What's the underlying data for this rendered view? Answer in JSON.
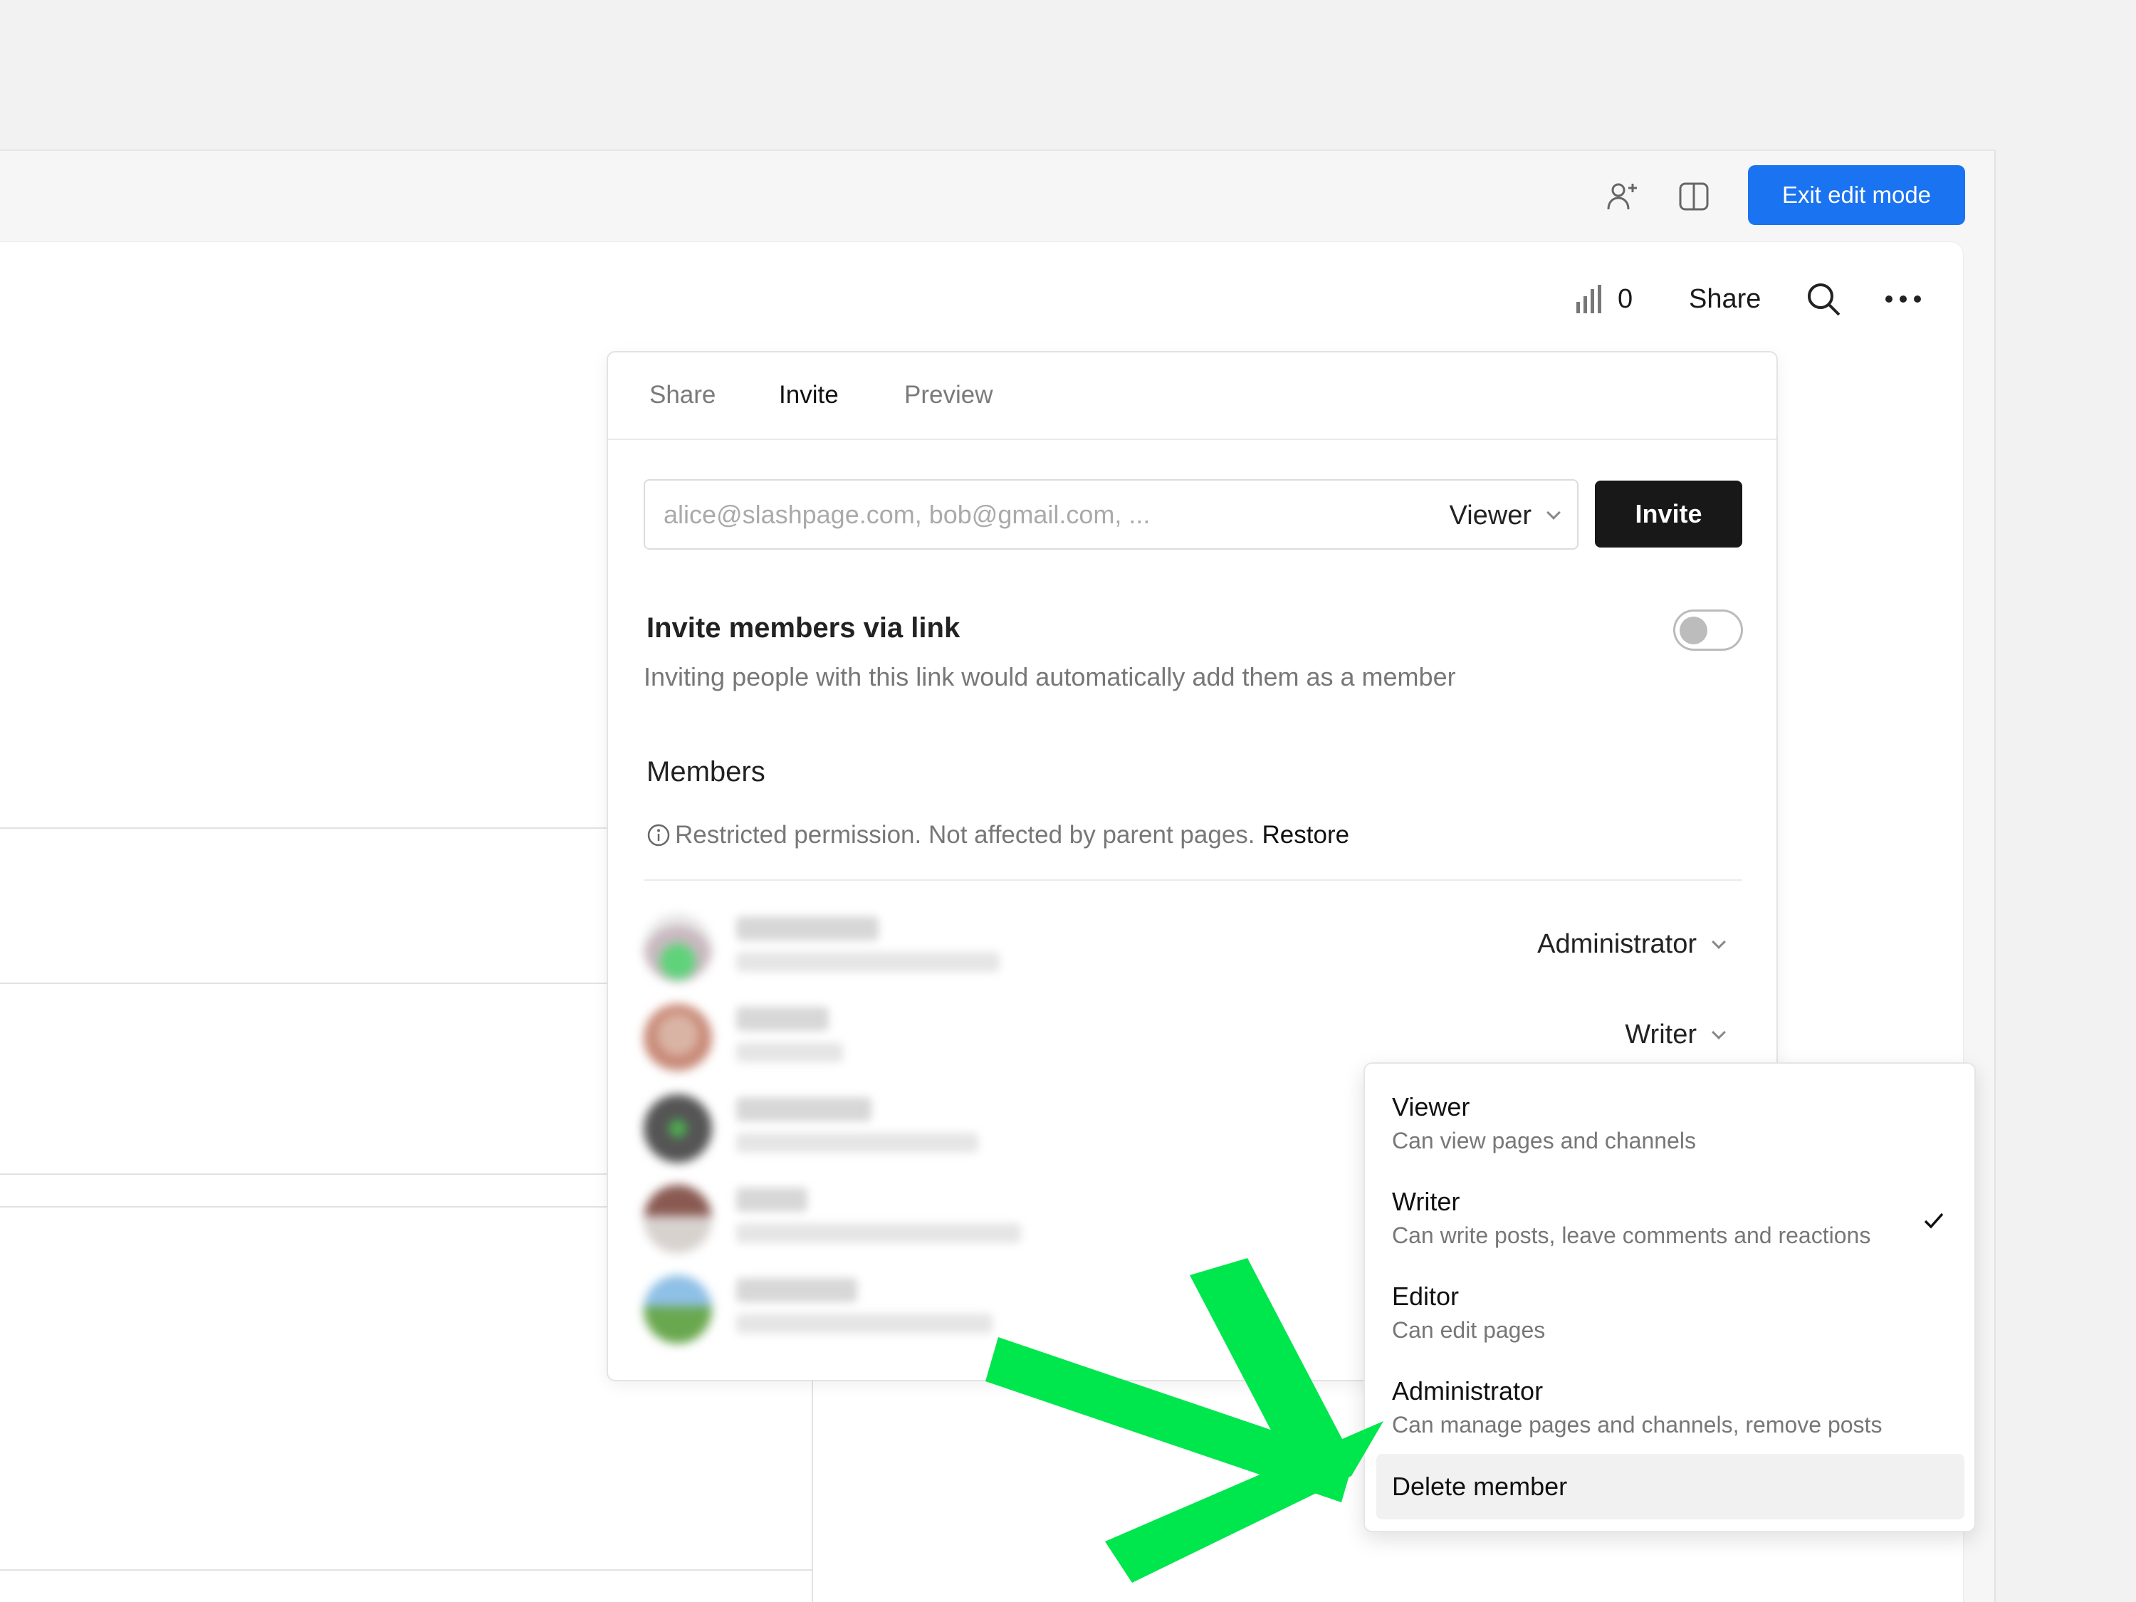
{
  "topbar": {
    "icons": [
      "add-person-icon",
      "split-view-icon"
    ],
    "exit_label": "Exit edit mode",
    "accent_color": "#1a73f0"
  },
  "toolbar": {
    "view_count": "0",
    "share_label": "Share",
    "icons": [
      "stats-icon",
      "search-icon",
      "more-icon"
    ]
  },
  "panel": {
    "tabs": [
      {
        "label": "Share",
        "active": false
      },
      {
        "label": "Invite",
        "active": true
      },
      {
        "label": "Preview",
        "active": false
      }
    ],
    "invite": {
      "placeholder": "alice@slashpage.com, bob@gmail.com, ...",
      "value": "",
      "role": "Viewer",
      "button_label": "Invite"
    },
    "via_link": {
      "title": "Invite members via link",
      "description": "Inviting people with this link would automatically add them as a member",
      "enabled": false
    },
    "members": {
      "title": "Members",
      "restricted_text": "Restricted permission. Not affected by parent pages.",
      "restore_label": "Restore",
      "rows": [
        {
          "role": "Administrator"
        },
        {
          "role": "Writer"
        },
        {
          "role": ""
        },
        {
          "role": ""
        },
        {
          "role": ""
        }
      ]
    }
  },
  "dropdown": {
    "options": [
      {
        "title": "Viewer",
        "desc": "Can view pages and channels",
        "selected": false
      },
      {
        "title": "Writer",
        "desc": "Can write posts, leave comments and reactions",
        "selected": true
      },
      {
        "title": "Editor",
        "desc": "Can edit pages",
        "selected": false
      },
      {
        "title": "Administrator",
        "desc": "Can manage pages and channels, remove posts",
        "selected": false
      }
    ],
    "delete_label": "Delete member"
  },
  "annotation": {
    "arrow_color": "#00e64d"
  }
}
